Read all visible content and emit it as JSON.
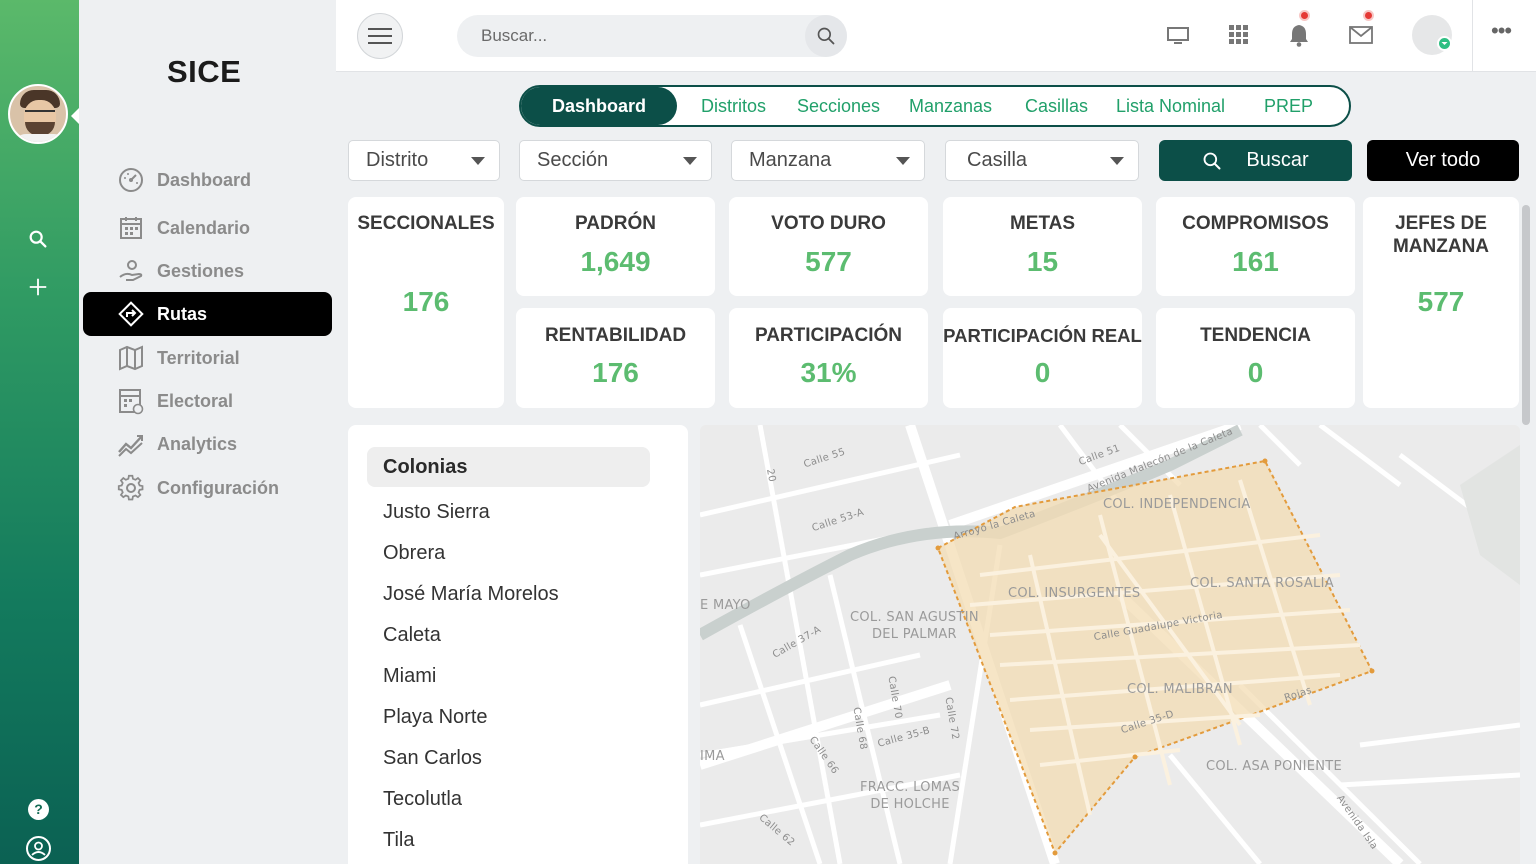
{
  "app": {
    "brand": "SICE"
  },
  "colors": {
    "accent": "#0c4f48",
    "green": "#5cbc70",
    "rail_top": "#5bb96a",
    "rail_bottom": "#0b6153"
  },
  "sidebar": {
    "items": [
      {
        "label": "Dashboard",
        "icon": "speedometer-icon"
      },
      {
        "label": "Calendario",
        "icon": "calendar-icon"
      },
      {
        "label": "Gestiones",
        "icon": "hand-coin-icon"
      },
      {
        "label": "Rutas",
        "icon": "route-sign-icon",
        "active": true
      },
      {
        "label": "Territorial",
        "icon": "map-icon"
      },
      {
        "label": "Electoral",
        "icon": "ballot-icon"
      },
      {
        "label": "Analytics",
        "icon": "trend-icon"
      },
      {
        "label": "Configuración",
        "icon": "gear-icon"
      }
    ]
  },
  "topbar": {
    "search_placeholder": "Buscar...",
    "icons": [
      "monitor-icon",
      "apps-grid-icon",
      "bell-icon",
      "mail-icon"
    ]
  },
  "tabs": [
    "Dashboard",
    "Distritos",
    "Secciones",
    "Manzanas",
    "Casillas",
    "Lista Nominal",
    "PREP"
  ],
  "filters": {
    "distrito": "Distrito",
    "seccion": "Sección",
    "manzana": "Manzana",
    "casilla": "Casilla",
    "search_button": "Buscar",
    "view_all_button": "Ver todo"
  },
  "stats": {
    "seccionales": {
      "label": "SECCIONALES",
      "value": "176"
    },
    "padron": {
      "label": "PADRÓN",
      "value": "1,649"
    },
    "voto_duro": {
      "label": "VOTO DURO",
      "value": "577"
    },
    "metas": {
      "label": "METAS",
      "value": "15"
    },
    "compromisos": {
      "label": "COMPROMISOS",
      "value": "161"
    },
    "jefes": {
      "label_1": "JEFES DE",
      "label_2": "MANZANA",
      "value": "577"
    },
    "rentabilidad": {
      "label": "RENTABILIDAD",
      "value": "176"
    },
    "participacion": {
      "label": "PARTICIPACIÓN",
      "value": "31%"
    },
    "participacion_real": {
      "label": "PARTICIPACIÓN REAL",
      "value": "0"
    },
    "tendencia": {
      "label": "TENDENCIA",
      "value": "0"
    }
  },
  "colonias": {
    "header": "Colonias",
    "items": [
      "Justo Sierra",
      "Obrera",
      "José María Morelos",
      "Caleta",
      "Miami",
      "Playa Norte",
      "San Carlos",
      "Tecolutla",
      "Tila"
    ]
  },
  "map": {
    "labels": {
      "independencia": "COL. INDEPENDENCIA",
      "insurgentes": "COL. INSURGENTES",
      "santa_rosalia": "COL. SANTA ROSALIA",
      "san_agustin_1": "COL. SAN AGUSTIN",
      "san_agustin_2": "DEL PALMAR",
      "malibran": "COL. MALIBRAN",
      "asa_poniente": "COL. ASA PONIENTE",
      "lomas_1": "FRACC. LOMAS",
      "lomas_2": "DE HOLCHE",
      "mayo": "E MAYO",
      "ima": "IMA",
      "arroyo": "Arroyo la Caleta",
      "malecon": "Avenida Malecón de la Caleta",
      "calle55": "Calle 55",
      "calle51": "Calle 51",
      "calle20": "20",
      "calle53a": "Calle 53-A",
      "calle37a": "Calle 37-A",
      "calle70": "Calle 70",
      "calle72": "Calle 72",
      "calle68": "Calle 68",
      "calle35b": "Calle 35-B",
      "calle66": "Calle 66",
      "calle62": "Calle 62",
      "guadalupe": "Calle Guadalupe Victoria",
      "calle35d": "Calle 35-D",
      "rojas": "Rojas",
      "isla": "Avenida Isla"
    }
  }
}
